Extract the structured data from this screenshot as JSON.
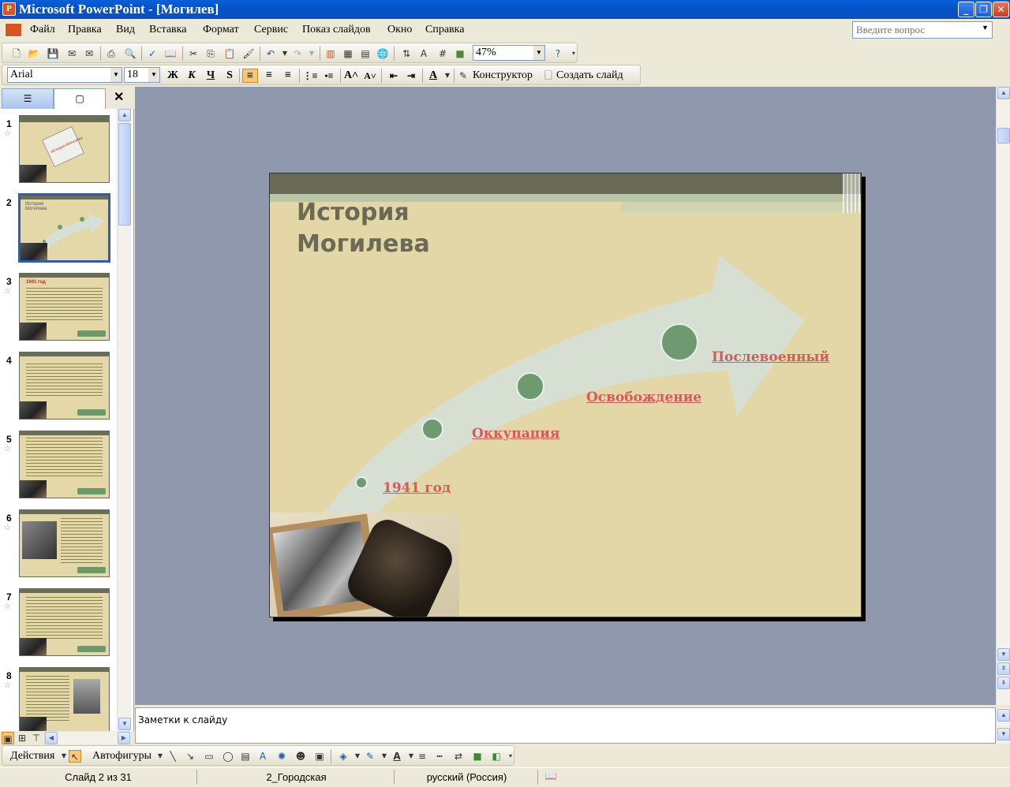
{
  "window": {
    "title": "Microsoft PowerPoint - [Могилев]",
    "app_icon": "P"
  },
  "menu": {
    "items": [
      "Файл",
      "Правка",
      "Вид",
      "Вставка",
      "Формат",
      "Сервис",
      "Показ слайдов",
      "Окно",
      "Справка"
    ],
    "ask_placeholder": "Введите вопрос"
  },
  "toolbar": {
    "zoom": "47%",
    "font": "Arial",
    "font_size": "18",
    "bold": "Ж",
    "italic": "К",
    "underline": "Ч",
    "shadow": "S",
    "designer": "Конструктор",
    "new_slide": "Создать слайд"
  },
  "thumbnails": [
    {
      "num": "1",
      "label": "История Могилева"
    },
    {
      "num": "2",
      "label": "История Могилева"
    },
    {
      "num": "3",
      "label": "1941 год"
    },
    {
      "num": "4",
      "label": ""
    },
    {
      "num": "5",
      "label": ""
    },
    {
      "num": "6",
      "label": ""
    },
    {
      "num": "7",
      "label": ""
    },
    {
      "num": "8",
      "label": ""
    }
  ],
  "slide": {
    "title_line1": "История",
    "title_line2": "Могилева",
    "links": [
      "1941 год",
      "Оккупация",
      "Освобождение",
      "Послевоенный"
    ]
  },
  "notes": {
    "placeholder": "Заметки к слайду"
  },
  "drawing": {
    "actions": "Действия",
    "autoshapes": "Автофигуры"
  },
  "status": {
    "slide": "Слайд 2 из 31",
    "design": "2_Городская",
    "language": "русский (Россия)"
  },
  "colors": {
    "title_bar": "#0353c9",
    "workspace": "#8f98ad",
    "slide_bg": "#e3d7a7",
    "link": "#d25b5b",
    "arrow": "#d5e0d8",
    "circle": "#6e9a72"
  }
}
